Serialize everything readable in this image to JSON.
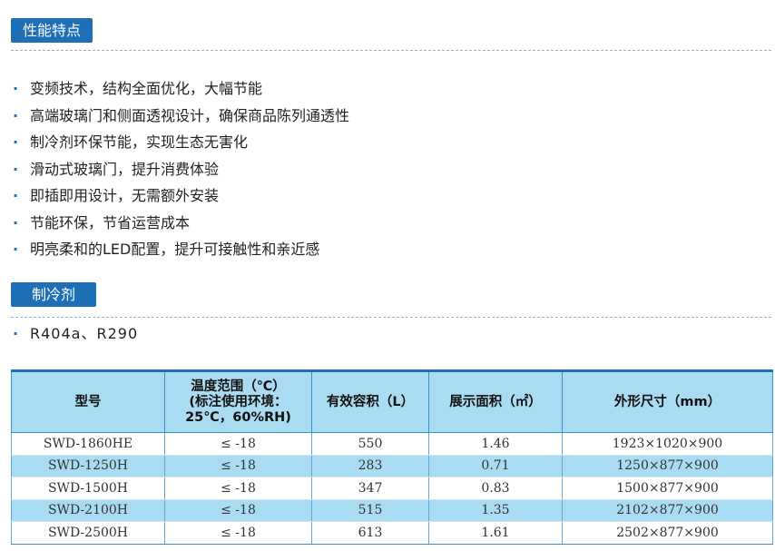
{
  "sections": {
    "features_title": "性能特点",
    "refrigerant_title": "制冷剂"
  },
  "bullet": "·",
  "features": [
    "变频技术，结构全面优化，大幅节能",
    "高端玻璃门和侧面透视设计，确保商品陈列通透性",
    "制冷剂环保节能，实现生态无害化",
    "滑动式玻璃门，提升消费体验",
    "即插即用设计，无需额外安装",
    "节能环保，节省运营成本",
    "明亮柔和的LED配置，提升可接触性和亲近感"
  ],
  "refrigerant": "R404a、R290",
  "table": {
    "headers": {
      "model": "型号",
      "temp_line1": "温度范围（℃）",
      "temp_line2": "(标注使用环境：",
      "temp_line3": "25℃，60%RH)",
      "volume": "有效容积（L）",
      "display_area": "展示面积（㎡）",
      "dimensions": "外形尺寸（mm）"
    },
    "rows": [
      {
        "model": "SWD-1860HE",
        "temp": "≤ -18",
        "volume": "550",
        "area": "1.46",
        "dims": "1923×1020×900"
      },
      {
        "model": "SWD-1250H",
        "temp": "≤ -18",
        "volume": "283",
        "area": "0.71",
        "dims": "1250×877×900"
      },
      {
        "model": "SWD-1500H",
        "temp": "≤ -18",
        "volume": "347",
        "area": "0.83",
        "dims": "1500×877×900"
      },
      {
        "model": "SWD-2100H",
        "temp": "≤ -18",
        "volume": "515",
        "area": "1.35",
        "dims": "2102×877×900"
      },
      {
        "model": "SWD-2500H",
        "temp": "≤ -18",
        "volume": "613",
        "area": "1.61",
        "dims": "2502×877×900"
      }
    ]
  },
  "colors": {
    "accent": "#1e6fb5",
    "table_band": "#a9dcf2"
  }
}
